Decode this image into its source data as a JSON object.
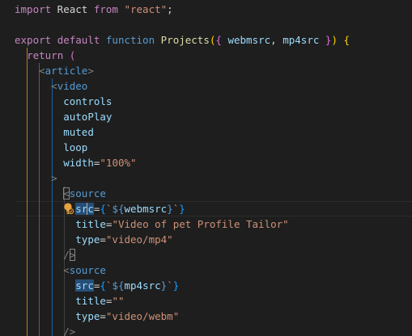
{
  "editor": {
    "language": "javascript-react",
    "lines": [
      [
        {
          "t": "import",
          "c": "kw-purple"
        },
        {
          "t": " React ",
          "c": "plain"
        },
        {
          "t": "from",
          "c": "kw-purple"
        },
        {
          "t": " ",
          "c": "plain"
        },
        {
          "t": "\"react\"",
          "c": "str"
        },
        {
          "t": ";",
          "c": "plain"
        }
      ],
      [],
      [
        {
          "t": "export",
          "c": "kw-purple"
        },
        {
          "t": " ",
          "c": "plain"
        },
        {
          "t": "default",
          "c": "kw-purple"
        },
        {
          "t": " ",
          "c": "plain"
        },
        {
          "t": "function",
          "c": "kw-blue"
        },
        {
          "t": " ",
          "c": "plain"
        },
        {
          "t": "Projects",
          "c": "fn"
        },
        {
          "t": "(",
          "c": "brace1"
        },
        {
          "t": "{",
          "c": "brace2"
        },
        {
          "t": " ",
          "c": "plain"
        },
        {
          "t": "webmsrc",
          "c": "var"
        },
        {
          "t": ", ",
          "c": "plain"
        },
        {
          "t": "mp4src",
          "c": "var"
        },
        {
          "t": " ",
          "c": "plain"
        },
        {
          "t": "}",
          "c": "brace2"
        },
        {
          "t": ")",
          "c": "brace1"
        },
        {
          "t": " ",
          "c": "plain"
        },
        {
          "t": "{",
          "c": "brace1"
        }
      ],
      [
        {
          "t": "  ",
          "c": "plain"
        },
        {
          "t": "return",
          "c": "kw-purple"
        },
        {
          "t": " ",
          "c": "plain"
        },
        {
          "t": "(",
          "c": "brace2"
        }
      ],
      [
        {
          "t": "    ",
          "c": "plain"
        },
        {
          "t": "<",
          "c": "punc"
        },
        {
          "t": "article",
          "c": "tag"
        },
        {
          "t": ">",
          "c": "punc"
        }
      ],
      [
        {
          "t": "      ",
          "c": "plain"
        },
        {
          "t": "<",
          "c": "punc"
        },
        {
          "t": "video",
          "c": "tag"
        }
      ],
      [
        {
          "t": "        ",
          "c": "plain"
        },
        {
          "t": "controls",
          "c": "var"
        }
      ],
      [
        {
          "t": "        ",
          "c": "plain"
        },
        {
          "t": "autoPlay",
          "c": "var"
        }
      ],
      [
        {
          "t": "        ",
          "c": "plain"
        },
        {
          "t": "muted",
          "c": "var"
        }
      ],
      [
        {
          "t": "        ",
          "c": "plain"
        },
        {
          "t": "loop",
          "c": "var"
        }
      ],
      [
        {
          "t": "        ",
          "c": "plain"
        },
        {
          "t": "width",
          "c": "var"
        },
        {
          "t": "=",
          "c": "plain"
        },
        {
          "t": "\"100%\"",
          "c": "str"
        }
      ],
      [
        {
          "t": "      ",
          "c": "plain"
        },
        {
          "t": ">",
          "c": "punc"
        }
      ],
      [
        {
          "t": "        ",
          "c": "plain"
        },
        {
          "t": "<",
          "c": "punc",
          "box": true
        },
        {
          "t": "source",
          "c": "tag"
        }
      ],
      [
        {
          "t": "          ",
          "c": "plain"
        },
        {
          "t": "sr",
          "c": "var",
          "sel": true
        },
        {
          "caret": true
        },
        {
          "t": "c",
          "c": "var",
          "sel": true
        },
        {
          "t": "=",
          "c": "plain"
        },
        {
          "t": "{",
          "c": "brace3"
        },
        {
          "t": "`",
          "c": "str"
        },
        {
          "t": "${",
          "c": "kw-blue"
        },
        {
          "t": "webmsrc",
          "c": "var"
        },
        {
          "t": "}",
          "c": "kw-blue"
        },
        {
          "t": "`",
          "c": "str"
        },
        {
          "t": "}",
          "c": "brace3"
        }
      ],
      [
        {
          "t": "          ",
          "c": "plain"
        },
        {
          "t": "title",
          "c": "var"
        },
        {
          "t": "=",
          "c": "plain"
        },
        {
          "t": "\"Video of pet Profile Tailor\"",
          "c": "str"
        }
      ],
      [
        {
          "t": "          ",
          "c": "plain"
        },
        {
          "t": "type",
          "c": "var"
        },
        {
          "t": "=",
          "c": "plain"
        },
        {
          "t": "\"video/mp4\"",
          "c": "str"
        }
      ],
      [
        {
          "t": "        ",
          "c": "plain"
        },
        {
          "t": "/",
          "c": "punc"
        },
        {
          "t": ">",
          "c": "punc",
          "box": true
        }
      ],
      [
        {
          "t": "        ",
          "c": "plain"
        },
        {
          "t": "<",
          "c": "punc"
        },
        {
          "t": "source",
          "c": "tag"
        }
      ],
      [
        {
          "t": "          ",
          "c": "plain"
        },
        {
          "t": "src",
          "c": "var",
          "sel": true
        },
        {
          "t": "=",
          "c": "plain"
        },
        {
          "t": "{",
          "c": "brace3"
        },
        {
          "t": "`",
          "c": "str"
        },
        {
          "t": "${",
          "c": "kw-blue"
        },
        {
          "t": "mp4src",
          "c": "var"
        },
        {
          "t": "}",
          "c": "kw-blue"
        },
        {
          "t": "`",
          "c": "str"
        },
        {
          "t": "}",
          "c": "brace3"
        }
      ],
      [
        {
          "t": "          ",
          "c": "plain"
        },
        {
          "t": "title",
          "c": "var"
        },
        {
          "t": "=",
          "c": "plain"
        },
        {
          "t": "\"\"",
          "c": "str"
        }
      ],
      [
        {
          "t": "          ",
          "c": "plain"
        },
        {
          "t": "type",
          "c": "var"
        },
        {
          "t": "=",
          "c": "plain"
        },
        {
          "t": "\"video/webm\"",
          "c": "str"
        }
      ],
      [
        {
          "t": "        ",
          "c": "plain"
        },
        {
          "t": "/>",
          "c": "punc"
        }
      ]
    ],
    "current_line_index": 13,
    "lightbulb_line_index": 13,
    "colors": {
      "background": "#1e1e1e",
      "guide_return": "#b3821e",
      "guide_article": "#8a3f84",
      "guide_video": "#1f5f99",
      "guide_source": "#404040"
    }
  }
}
